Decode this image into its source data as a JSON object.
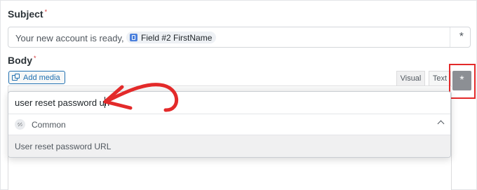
{
  "subject": {
    "label": "Subject",
    "required_mark": "*",
    "text": "Your new account is ready,",
    "chip_label": "Field #2 FirstName",
    "insert_symbol": "*"
  },
  "body": {
    "label": "Body",
    "required_mark": "*",
    "add_media_label": "Add media",
    "tab_visual": "Visual",
    "tab_text": "Text",
    "insert_symbol": "*"
  },
  "dropdown": {
    "search_value": "user reset password url",
    "group_label": "Common",
    "group_icon": "link-off-icon",
    "options": [
      {
        "label": "User reset password URL"
      }
    ]
  },
  "colors": {
    "highlight": "#e32a2a",
    "accent": "#2271b1"
  }
}
